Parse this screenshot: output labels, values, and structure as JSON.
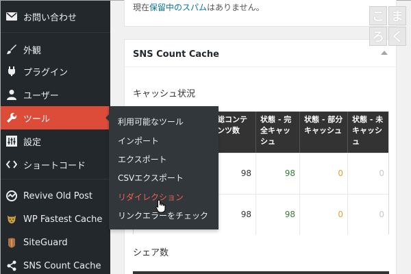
{
  "sidebar": {
    "items": [
      {
        "label": "お問い合わせ",
        "icon": "mail-icon"
      },
      {
        "label": "外観",
        "icon": "paintbrush-icon"
      },
      {
        "label": "プラグイン",
        "icon": "plugin-icon"
      },
      {
        "label": "ユーザー",
        "icon": "user-icon"
      },
      {
        "label": "ツール",
        "icon": "wrench-icon"
      },
      {
        "label": "設定",
        "icon": "settings-icon"
      },
      {
        "label": "ショートコード",
        "icon": "code-icon"
      },
      {
        "label": "Revive Old Post",
        "icon": "revive-icon"
      },
      {
        "label": "WP Fastest Cache",
        "icon": "cheetah-icon"
      },
      {
        "label": "SiteGuard",
        "icon": "shield-icon"
      },
      {
        "label": "SNS Count Cache",
        "icon": "share-icon"
      }
    ],
    "active_index": 4
  },
  "flyout": {
    "items": [
      "利用可能なツール",
      "インポート",
      "エクスポート",
      "CSVエクスポート",
      "リダイレクション",
      "リンクエラーをチェック"
    ],
    "hover_index": 4
  },
  "top_box": {
    "prefix": "現在",
    "link": "保留中のスパム",
    "suffix": "はありません。"
  },
  "postbox": {
    "title": "SNS Count Cache",
    "cache_label": "キャッシュ状況",
    "share_label": "シェア数",
    "headers": [
      "総コンテンツ数",
      "状態 - 完全キャッシュ",
      "状態 - 部分キャッシュ",
      "状態 - 未キャッシュ"
    ],
    "rows": [
      [
        "98",
        "98",
        "0",
        "0"
      ],
      [
        "98",
        "98",
        "0",
        "0"
      ]
    ]
  },
  "logo": [
    "こ",
    "ま",
    "ろ",
    "く"
  ],
  "colors": {
    "sidebar_bg": "#23282d",
    "active": "#dd4b39",
    "link": "#0073aa",
    "full": "#3a7d3a",
    "partial": "#e0a030"
  }
}
